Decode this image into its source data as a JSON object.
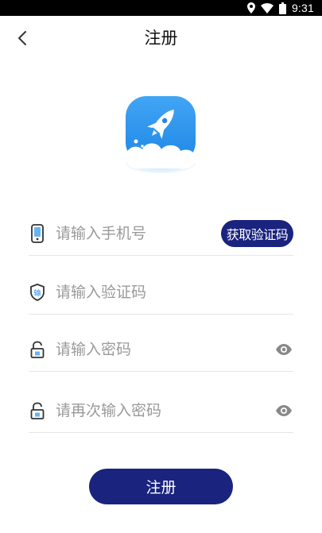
{
  "status_bar": {
    "time": "9:31",
    "icons": [
      "location-icon",
      "wifi-icon",
      "battery-icon"
    ]
  },
  "header": {
    "title": "注册",
    "back_icon": "chevron-left-icon"
  },
  "logo": {
    "icon": "rocket-icon",
    "colors": {
      "tile": "#2196f3",
      "cloud": "#ffffff"
    }
  },
  "form": {
    "phone": {
      "placeholder": "请输入手机号",
      "icon": "phone-icon"
    },
    "get_code_label": "获取验证码",
    "code": {
      "placeholder": "请输入验证码",
      "icon": "shield-icon",
      "badge": "输"
    },
    "password": {
      "placeholder": "请输入密码",
      "icon": "lock-icon",
      "toggle_icon": "eye-icon"
    },
    "confirm_password": {
      "placeholder": "请再次输入密码",
      "icon": "lock-icon",
      "toggle_icon": "eye-icon"
    }
  },
  "register_label": "注册",
  "colors": {
    "accent": "#1a237e",
    "placeholder": "#9a9a9a",
    "divider": "#e6e6e6"
  }
}
